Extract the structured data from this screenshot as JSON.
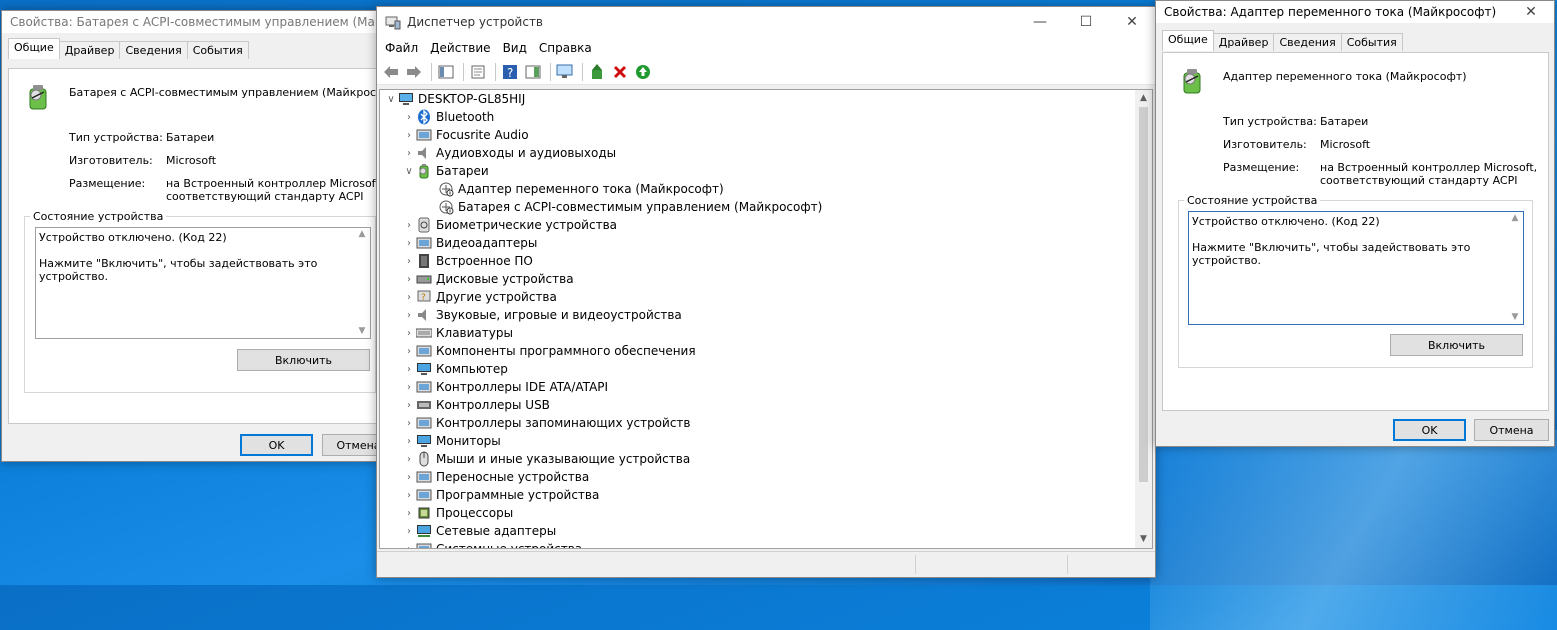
{
  "left_dialog": {
    "title": "Свойства: Батарея с ACPI-совместимым управлением (Майкрософт)",
    "tabs": [
      "Общие",
      "Драйвер",
      "Сведения",
      "События"
    ],
    "device_name": "Батарея с ACPI-совместимым управлением (Майкрософт)",
    "type_label": "Тип устройства:",
    "type_value": "Батареи",
    "maker_label": "Изготовитель:",
    "maker_value": "Microsoft",
    "location_label": "Размещение:",
    "location_value_1": "на Встроенный контроллер Microsoft,",
    "location_value_2": "соответствующий стандарту ACPI",
    "status_caption": "Состояние устройства",
    "status_line1": "Устройство отключено. (Код 22)",
    "status_line2": "Нажмите \"Включить\", чтобы задействовать это устройство.",
    "enable_button": "Включить",
    "ok_button": "OK",
    "cancel_button": "Отмена"
  },
  "device_manager": {
    "title": "Диспетчер устройств",
    "menu": [
      "Файл",
      "Действие",
      "Вид",
      "Справка"
    ],
    "root": "DESKTOP-GL85HIJ",
    "tree": [
      {
        "label": "Bluetooth",
        "icon": "bluetooth-icon",
        "expanded": false
      },
      {
        "label": "Focusrite Audio",
        "icon": "audio-device-icon",
        "expanded": false
      },
      {
        "label": "Аудиовходы и аудиовыходы",
        "icon": "speaker-icon",
        "expanded": false
      },
      {
        "label": "Батареи",
        "icon": "battery-icon",
        "expanded": true
      },
      {
        "label": "Биометрические устройства",
        "icon": "fingerprint-icon",
        "expanded": false
      },
      {
        "label": "Видеоадаптеры",
        "icon": "display-adapter-icon",
        "expanded": false
      },
      {
        "label": "Встроенное ПО",
        "icon": "firmware-icon",
        "expanded": false
      },
      {
        "label": "Дисковые устройства",
        "icon": "disk-drive-icon",
        "expanded": false
      },
      {
        "label": "Другие устройства",
        "icon": "unknown-device-icon",
        "expanded": false
      },
      {
        "label": "Звуковые, игровые и видеоустройства",
        "icon": "sound-icon",
        "expanded": false
      },
      {
        "label": "Клавиатуры",
        "icon": "keyboard-icon",
        "expanded": false
      },
      {
        "label": "Компоненты программного обеспечения",
        "icon": "software-component-icon",
        "expanded": false
      },
      {
        "label": "Компьютер",
        "icon": "computer-icon",
        "expanded": false
      },
      {
        "label": "Контроллеры IDE ATA/ATAPI",
        "icon": "ide-controller-icon",
        "expanded": false
      },
      {
        "label": "Контроллеры USB",
        "icon": "usb-icon",
        "expanded": false
      },
      {
        "label": "Контроллеры запоминающих устройств",
        "icon": "storage-controller-icon",
        "expanded": false
      },
      {
        "label": "Мониторы",
        "icon": "monitor-icon",
        "expanded": false
      },
      {
        "label": "Мыши и иные указывающие устройства",
        "icon": "mouse-icon",
        "expanded": false
      },
      {
        "label": "Переносные устройства",
        "icon": "portable-device-icon",
        "expanded": false
      },
      {
        "label": "Программные устройства",
        "icon": "software-device-icon",
        "expanded": false
      },
      {
        "label": "Процессоры",
        "icon": "processor-icon",
        "expanded": false
      },
      {
        "label": "Сетевые адаптеры",
        "icon": "network-adapter-icon",
        "expanded": false
      },
      {
        "label": "Системные устройства",
        "icon": "system-device-icon",
        "expanded": false
      }
    ],
    "battery_children": [
      "Адаптер переменного тока (Майкрософт)",
      "Батарея с ACPI-совместимым управлением (Майкрософт)"
    ]
  },
  "right_dialog": {
    "title": "Свойства: Адаптер переменного тока (Майкрософт)",
    "tabs": [
      "Общие",
      "Драйвер",
      "Сведения",
      "События"
    ],
    "device_name": "Адаптер переменного тока (Майкрософт)",
    "type_label": "Тип устройства:",
    "type_value": "Батареи",
    "maker_label": "Изготовитель:",
    "maker_value": "Microsoft",
    "location_label": "Размещение:",
    "location_value_1": "на Встроенный контроллер Microsoft,",
    "location_value_2": "соответствующий стандарту ACPI",
    "status_caption": "Состояние устройства",
    "status_line1": "Устройство отключено. (Код 22)",
    "status_line2": "Нажмите \"Включить\", чтобы задействовать это устройство.",
    "enable_button": "Включить",
    "ok_button": "OK",
    "cancel_button": "Отмена"
  }
}
